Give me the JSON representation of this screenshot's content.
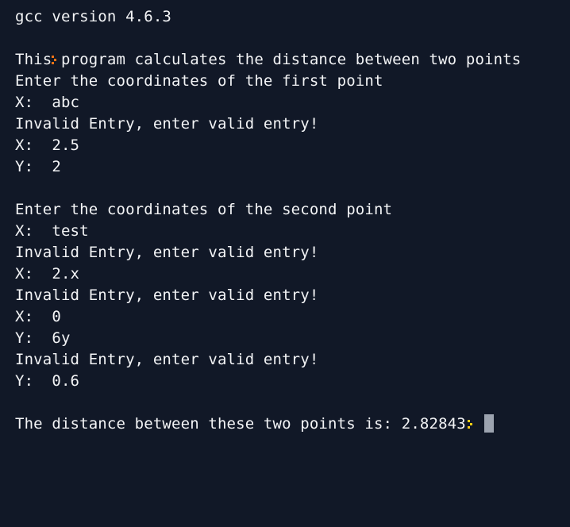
{
  "colors": {
    "background": "#111827",
    "text": "#f3f4f6",
    "prompt_primary": "#f97316",
    "prompt_secondary": "#facc15",
    "cursor": "#9ca3af"
  },
  "terminal": {
    "header": "gcc version 4.6.3",
    "prompt_icon": "prompt-arrow-icon",
    "lines": [
      "This program calculates the distance between two points",
      "Enter the coordinates of the first point",
      "X:  abc",
      "Invalid Entry, enter valid entry!",
      "X:  2.5",
      "Y:  2",
      "",
      "Enter the coordinates of the second point",
      "X:  test",
      "Invalid Entry, enter valid entry!",
      "X:  2.x",
      "Invalid Entry, enter valid entry!",
      "X:  0",
      "Y:  6y",
      "Invalid Entry, enter valid entry!",
      "Y:  0.6",
      ""
    ],
    "result_line": "The distance between these two points is: 2.82843"
  }
}
